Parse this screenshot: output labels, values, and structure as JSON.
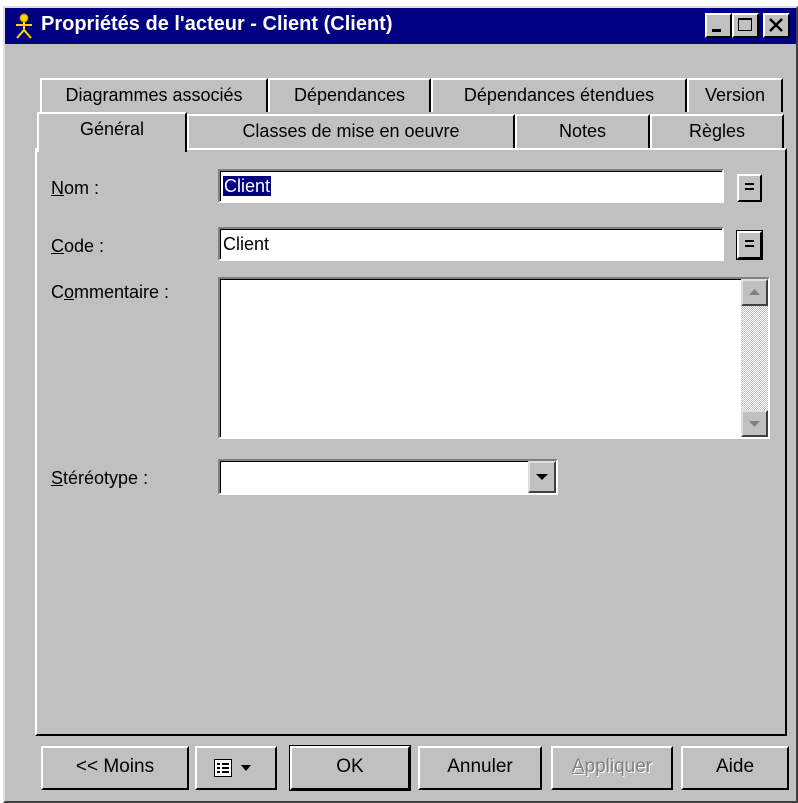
{
  "window": {
    "title": "Propriétés de l'acteur - Client (Client)"
  },
  "tabs": {
    "back_row": [
      "Diagrammes associés",
      "Dépendances",
      "Dépendances étendues",
      "Version"
    ],
    "front_row": [
      "Général",
      "Classes de mise en oeuvre",
      "Notes",
      "Règles"
    ],
    "active": "Général"
  },
  "form": {
    "name_label_key": "N",
    "name_label_rest": "om :",
    "name_value": "Client",
    "code_label_key": "C",
    "code_label_rest": "ode :",
    "code_value": "Client",
    "comment_label_pre": "C",
    "comment_label_key": "o",
    "comment_label_rest": "mmentaire :",
    "comment_value": "",
    "stereotype_label_key": "S",
    "stereotype_label_rest": "téréotype :",
    "stereotype_value": "",
    "equals_label": "="
  },
  "buttons": {
    "less": "<< Moins",
    "ok": "OK",
    "cancel": "Annuler",
    "apply_key": "A",
    "apply_rest": "ppliquer",
    "help": "Aide"
  },
  "icons": {
    "title": "actor-icon",
    "minimize": "minimize-icon",
    "maximize": "maximize-icon",
    "close": "close-icon",
    "menu": "list-menu-icon",
    "dropdown": "chevron-down-icon"
  }
}
